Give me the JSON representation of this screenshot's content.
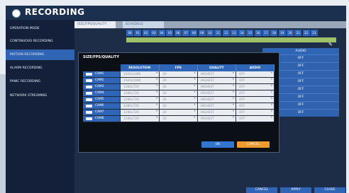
{
  "app": {
    "title": "RECORDING"
  },
  "sidebar": {
    "items": [
      {
        "label": "OPERATION MODE"
      },
      {
        "label": "CONTINUOUS RECORDING"
      },
      {
        "label": "MOTION RECORDING",
        "active": true
      },
      {
        "label": "ALARM RECORDING"
      },
      {
        "label": "PANIC RECORDING"
      },
      {
        "label": "NETWORK STREAMING"
      }
    ]
  },
  "tabs": [
    {
      "label": "SIZE/FPS/QUALITY"
    },
    {
      "label": "SCHEDULE"
    }
  ],
  "channels": [
    "00",
    "01",
    "02",
    "03",
    "04",
    "05",
    "06",
    "07",
    "08",
    "09",
    "10",
    "11",
    "12",
    "13",
    "14",
    "15",
    "16",
    "17",
    "18",
    "19",
    "20",
    "21",
    "22",
    "23"
  ],
  "background_table": {
    "header": "AUDIO",
    "rows": [
      "OFF",
      "OFF",
      "OFF",
      "OFF",
      "OFF",
      "OFF",
      "OFF",
      "OFF"
    ]
  },
  "dialog": {
    "title": "SIZE/FPS/QUALITY",
    "headers": [
      "RESOLUTION",
      "FPS",
      "QUALITY",
      "AUDIO"
    ],
    "rows": [
      {
        "cam": "CAM1",
        "resolution": "1920x1080",
        "fps": "30",
        "quality": "HIGHEST",
        "audio": "OFF"
      },
      {
        "cam": "CAM2",
        "resolution": "1920x1080",
        "fps": "30",
        "quality": "HIGHEST",
        "audio": "OFF"
      },
      {
        "cam": "CAM3",
        "resolution": "1280x720",
        "fps": "30",
        "quality": "HIGHEST",
        "audio": "OFF"
      },
      {
        "cam": "CAM4",
        "resolution": "1280x720",
        "fps": "30",
        "quality": "HIGHEST",
        "audio": "OFF"
      },
      {
        "cam": "CAM5",
        "resolution": "1280x720",
        "fps": "30",
        "quality": "HIGHEST",
        "audio": "OFF"
      },
      {
        "cam": "CAM6",
        "resolution": "1280x720",
        "fps": "30",
        "quality": "HIGHEST",
        "audio": "OFF"
      },
      {
        "cam": "CAM7",
        "resolution": "1280x720",
        "fps": "30",
        "quality": "HIGHEST",
        "audio": "OFF"
      },
      {
        "cam": "CAM8",
        "resolution": "1280x720",
        "fps": "30",
        "quality": "HIGHEST",
        "audio": "OFF"
      }
    ],
    "ok_label": "OK",
    "cancel_label": "CANCEL"
  },
  "footer": {
    "cancel_label": "CANCEL",
    "apply_label": "APPLY",
    "close_label": "CLOSE"
  },
  "colors": {
    "accent": "#2f65b4",
    "cancel": "#f29a2b",
    "ok": "#2f77d1",
    "dark": "#1b2f4f"
  }
}
